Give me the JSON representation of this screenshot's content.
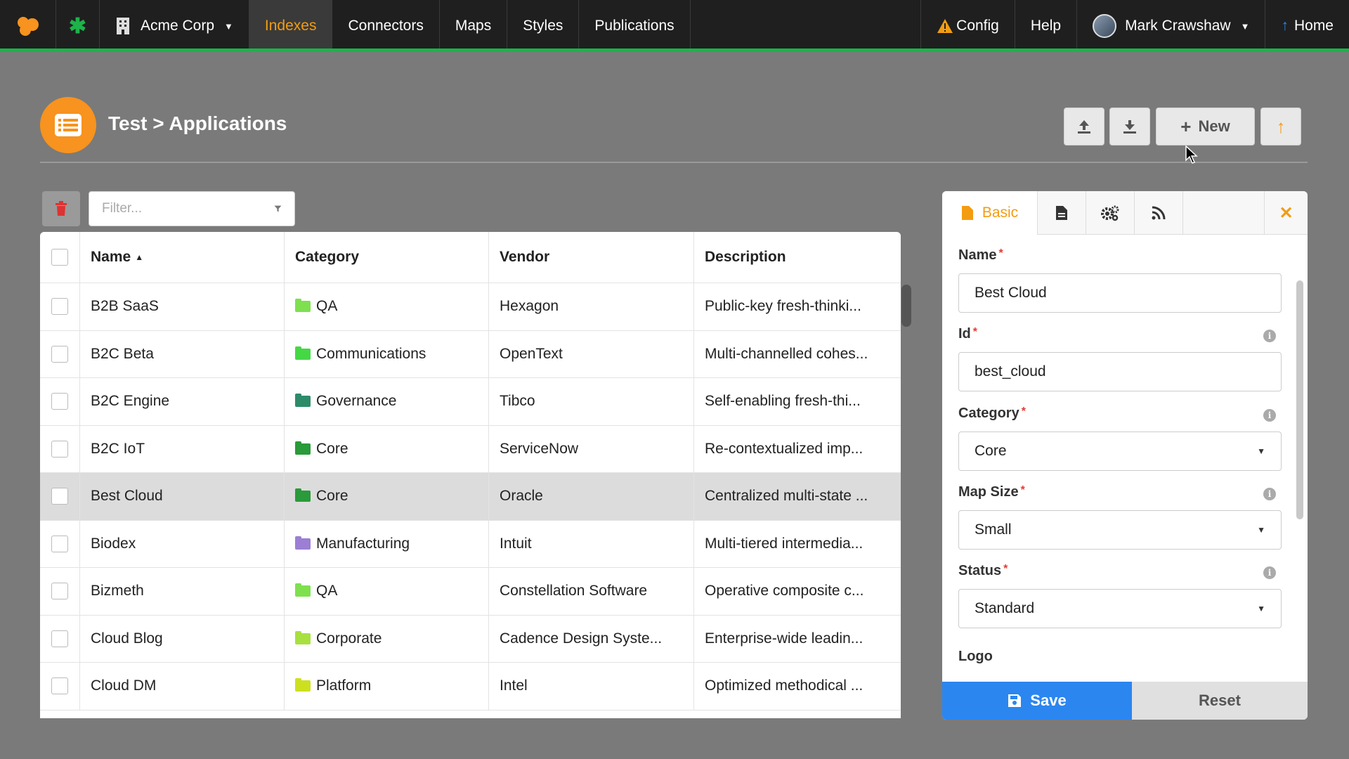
{
  "nav": {
    "org_name": "Acme Corp",
    "items": [
      {
        "label": "Indexes",
        "active": true
      },
      {
        "label": "Connectors",
        "active": false
      },
      {
        "label": "Maps",
        "active": false
      },
      {
        "label": "Styles",
        "active": false
      },
      {
        "label": "Publications",
        "active": false
      }
    ],
    "config_label": "Config",
    "help_label": "Help",
    "user_name": "Mark Crawshaw",
    "home_label": "Home",
    "accent_color": "#f39c12",
    "brand_green": "#1db34a"
  },
  "header": {
    "title": "Test > Applications",
    "new_label": "New"
  },
  "filter": {
    "placeholder": "Filter..."
  },
  "table": {
    "columns": [
      "Name",
      "Category",
      "Vendor",
      "Description"
    ],
    "sort_indicator": "▲",
    "rows": [
      {
        "name": "B2B SaaS",
        "category": "QA",
        "folder_color": "#7ee04f",
        "vendor": "Hexagon",
        "description": "Public-key fresh-thinki...",
        "selected": false
      },
      {
        "name": "B2C Beta",
        "category": "Communications",
        "folder_color": "#45d845",
        "vendor": "OpenText",
        "description": "Multi-channelled cohes...",
        "selected": false
      },
      {
        "name": "B2C Engine",
        "category": "Governance",
        "folder_color": "#2e8b6a",
        "vendor": "Tibco",
        "description": "Self-enabling fresh-thi...",
        "selected": false
      },
      {
        "name": "B2C IoT",
        "category": "Core",
        "folder_color": "#2a9a3a",
        "vendor": "ServiceNow",
        "description": "Re-contextualized imp...",
        "selected": false
      },
      {
        "name": "Best Cloud",
        "category": "Core",
        "folder_color": "#2a9a3a",
        "vendor": "Oracle",
        "description": "Centralized multi-state ...",
        "selected": true
      },
      {
        "name": "Biodex",
        "category": "Manufacturing",
        "folder_color": "#9b7fd4",
        "vendor": "Intuit",
        "description": "Multi-tiered intermedia...",
        "selected": false
      },
      {
        "name": "Bizmeth",
        "category": "QA",
        "folder_color": "#7ee04f",
        "vendor": "Constellation Software",
        "description": "Operative composite c...",
        "selected": false
      },
      {
        "name": "Cloud Blog",
        "category": "Corporate",
        "folder_color": "#a8e040",
        "vendor": "Cadence Design Syste...",
        "description": "Enterprise-wide leadin...",
        "selected": false
      },
      {
        "name": "Cloud DM",
        "category": "Platform",
        "folder_color": "#cde020",
        "vendor": "Intel",
        "description": "Optimized methodical ...",
        "selected": false
      }
    ]
  },
  "panel": {
    "tab_basic": "Basic",
    "fields": {
      "name_label": "Name",
      "name_value": "Best Cloud",
      "id_label": "Id",
      "id_value": "best_cloud",
      "category_label": "Category",
      "category_value": "Core",
      "map_size_label": "Map Size",
      "map_size_value": "Small",
      "status_label": "Status",
      "status_value": "Standard",
      "logo_label": "Logo"
    },
    "save_label": "Save",
    "reset_label": "Reset",
    "save_color": "#2b86f0"
  }
}
